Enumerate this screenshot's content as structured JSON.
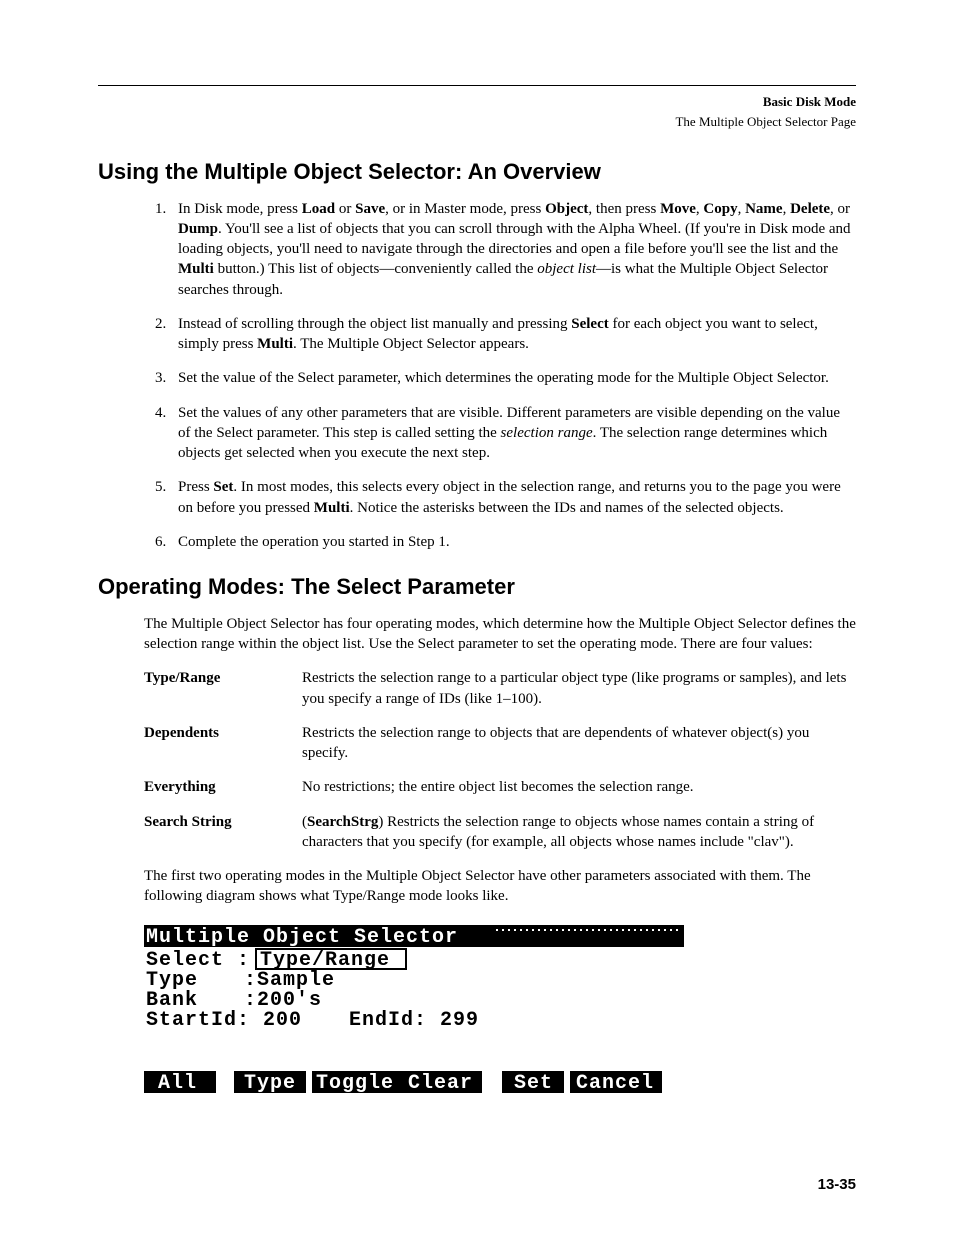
{
  "header": {
    "title": "Basic Disk Mode",
    "subtitle": "The Multiple Object Selector Page"
  },
  "section1": {
    "heading": "Using the Multiple Object Selector: An Overview",
    "step1": {
      "a": "In Disk mode, press ",
      "b1": "Load",
      "c": " or ",
      "b2": "Save",
      "d": ", or in Master mode, press ",
      "b3": "Object",
      "e": ", then press ",
      "b4": "Move",
      "f": ", ",
      "b5": "Copy",
      "g": ", ",
      "b6": "Name",
      "h": ", ",
      "b7": "Delete",
      "i": ", or ",
      "b8": "Dump",
      "j": ". You'll see a list of objects that you can scroll through with the Alpha Wheel. (If you're in Disk mode and loading objects, you'll need to navigate through the directories and open a file before you'll see the list and the ",
      "b9": "Multi",
      "k": " button.) This list of objects—conveniently called the ",
      "it1": "object list",
      "l": "—is what the Multiple Object Selector searches through."
    },
    "step2": {
      "a": "Instead of scrolling through the object list manually and pressing ",
      "b1": "Select",
      "c": " for each object you want to select, simply press ",
      "b2": "Multi",
      "d": ". The Multiple Object Selector appears."
    },
    "step3": "Set the value of the Select parameter, which determines the operating mode for the Multiple Object Selector.",
    "step4": {
      "a": "Set the values of any other parameters that are visible. Different parameters are visible depending on the value of the Select parameter. This step is called setting the ",
      "it1": "selection range",
      "b": ". The selection range determines which objects get selected when you execute the next step."
    },
    "step5": {
      "a": "Press ",
      "b1": "Set",
      "c": ". In most modes, this selects every object in the selection range, and returns you to the page you were on before you pressed ",
      "b2": "Multi",
      "d": ". Notice the asterisks between the IDs and names of the selected objects."
    },
    "step6": "Complete the operation you started in Step  1."
  },
  "section2": {
    "heading": "Operating Modes: The Select Parameter",
    "intro": "The Multiple Object Selector has four operating modes, which determine how the Multiple Object Selector defines the selection range within the object list. Use the Select parameter to set the operating mode. There are four values:",
    "defs": [
      {
        "term": "Type/Range",
        "body": "Restricts the selection range to a particular object type (like programs or samples), and lets you specify a range of IDs (like 1–100)."
      },
      {
        "term": "Dependents",
        "body": "Restricts the selection range to objects that are dependents of whatever object(s) you specify."
      },
      {
        "term": "Everything",
        "body": "No restrictions; the entire object list becomes the selection range."
      },
      {
        "term": "Search String",
        "bold": "SearchStrg",
        "pre": "(",
        "post": ") Restricts the selection range to objects whose names contain a string of characters that you specify (for example, all objects whose names include \"clav\")."
      }
    ],
    "outro": "The first two operating modes in the Multiple Object Selector have other parameters associated with them. The following diagram shows what Type/Range mode looks like."
  },
  "lcd": {
    "title": "Multiple Object Selector",
    "rows": {
      "select_label": "Select",
      "select_value": "Type/Range",
      "type_label": "Type",
      "type_value": "Sample",
      "bank_label": "Bank",
      "bank_value": "200's",
      "startid_label": "StartId:",
      "startid_value": "200",
      "endid_label": "EndId:",
      "endid_value": "299"
    },
    "buttons": [
      "All",
      "Type",
      "Toggle",
      "Clear",
      "Set",
      "Cancel"
    ]
  },
  "pagenum": "13-35"
}
